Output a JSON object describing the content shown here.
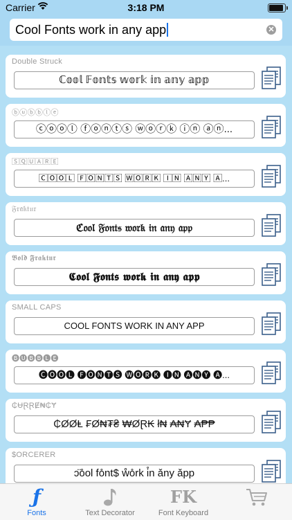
{
  "status_bar": {
    "carrier": "Carrier",
    "time": "3:18 PM"
  },
  "search": {
    "value": "Cool Fonts work in any app"
  },
  "fonts": [
    {
      "name": "Double Struck",
      "preview": "ℂ𝕠𝕠𝕝 𝔽𝕠𝕟𝕥𝕤 𝕨𝕠𝕣𝕜 𝕚𝕟 𝕒𝕟𝕪 𝕒𝕡𝕡"
    },
    {
      "name": "ⓑⓤⓑⓑⓛⓔ",
      "preview": "ⓒⓞⓞⓛ ⓕⓞⓝⓣⓢ ⓦⓞⓡⓚ ⓘⓝ ⓐⓝ..."
    },
    {
      "name": "🅂🅀🅄🄰🅁🄴",
      "preview": "🄲🄾🄾🄻 🄵🄾🄽🅃🅂 🅆🄾🅁🄺 🄸🄽 🄰🄽🅈 🄰..."
    },
    {
      "name": "𝔉𝔯𝔞𝔨𝔱𝔲𝔯",
      "preview": "ℭ𝔬𝔬𝔩 𝔉𝔬𝔫𝔱𝔰 𝔴𝔬𝔯𝔨 𝔦𝔫 𝔞𝔫𝔶 𝔞𝔭𝔭"
    },
    {
      "name": "𝕭𝖔𝖑𝖉 𝕱𝖗𝖆𝖐𝖙𝖚𝖗",
      "preview": "𝕮𝖔𝖔𝖑 𝕱𝖔𝖓𝖙𝖘 𝖜𝖔𝖗𝖐 𝖎𝖓 𝖆𝖓𝖞 𝖆𝖕𝖕"
    },
    {
      "name": "SMALL CAPS",
      "preview": "COOL FONTS WORK IN ANY APP"
    },
    {
      "name": "🅑🅤🅑🅑🅛🅔",
      "preview": "🅒🅞🅞🅛 🅕🅞🅝🅣🅢 🅦🅞🅡🅚 🅘🅝 🅐🅝🅨 🅐..."
    },
    {
      "name": "₵ɄⱤⱤɆ₦₵Ɏ",
      "preview": "₵ØØⱠ ₣Ø₦₮₴ ₩ØⱤ₭ ł₦ ₳₦Ɏ ₳₱₱"
    },
    {
      "name": "$ORCERER",
      "preview": "ↄ̈o̊ol fo̊nt$ ẘo̊rk i̊n ǎny ǎpp"
    }
  ],
  "tabs": [
    {
      "label": "Fonts",
      "icon": "fonts-icon"
    },
    {
      "label": "Text Decorator",
      "icon": "music-note-icon"
    },
    {
      "label": "Font Keyboard",
      "icon": "fk-icon"
    },
    {
      "label": "",
      "icon": "cart-icon"
    }
  ],
  "colors": {
    "accent": "#1a73e8",
    "list_bg": "#b3dff5",
    "header_bg": "#a9d8f3"
  }
}
